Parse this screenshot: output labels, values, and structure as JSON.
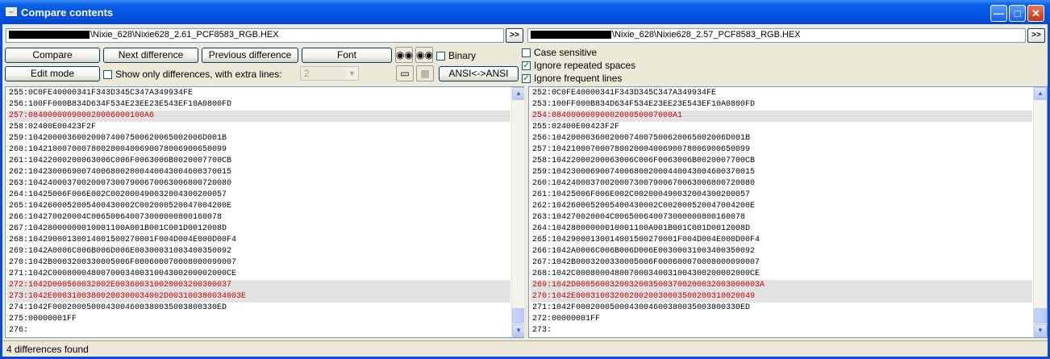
{
  "window": {
    "title": "Compare contents",
    "controls": [
      "minimize",
      "maximize",
      "close"
    ]
  },
  "left_file": {
    "path": "\\Nixie_628\\Nixie628_2.61_PCF8583_RGB.HEX",
    "browse_label": ">>"
  },
  "right_file": {
    "path": "\\Nixie_628\\Nixie628_2.57_PCF8583_RGB.HEX",
    "browse_label": ">>"
  },
  "toolbar": {
    "compare": "Compare",
    "next_difference": "Next difference",
    "previous_difference": "Previous difference",
    "font": "Font",
    "edit_mode": "Edit mode",
    "ansi": "ANSI<->ANSI",
    "find_icon": "binoculars-icon",
    "find_next_icon": "binoculars-next-icon",
    "split_icon": "layout-icon",
    "save_icon": "floppy-save-icon"
  },
  "options": {
    "binary": {
      "label": "Binary",
      "checked": false
    },
    "show_only_differences": {
      "label": "Show only differences, with extra lines:",
      "checked": false
    },
    "extra_lines_value": "2",
    "case_sensitive": {
      "label": "Case sensitive",
      "checked": false
    },
    "ignore_repeated_spaces": {
      "label": "Ignore repeated spaces",
      "checked": true
    },
    "ignore_frequent_lines": {
      "label": "Ignore frequent lines",
      "checked": true
    }
  },
  "left_lines": [
    {
      "n": "255",
      "t": ":0C0FE40000341F343D345C347A349934FE",
      "diff": false
    },
    {
      "n": "256",
      "t": ":100FF000B834D634F534E23EE23E543EF10A0800FD",
      "diff": false
    },
    {
      "n": "257",
      "t": ":084000000900020006000100A6",
      "diff": true
    },
    {
      "n": "258",
      "t": ":02400E00423F2F",
      "diff": false
    },
    {
      "n": "259",
      "t": ":104200003600200074007500620065002006D001B",
      "diff": false
    },
    {
      "n": "260",
      "t": ":10421000700078002000400690078006900650099",
      "diff": false
    },
    {
      "n": "261",
      "t": ":10422000200063006C006F0063006B0020007700CB",
      "diff": false
    },
    {
      "n": "262",
      "t": ":104230006900740068002000440043004600370015",
      "diff": false
    },
    {
      "n": "263",
      "t": ":104240003700200073007900670063006800720080",
      "diff": false
    },
    {
      "n": "264",
      "t": ":10425006F006E002C002000490032004300200057",
      "diff": false
    },
    {
      "n": "265",
      "t": ":1042600052005400430002C002000520047004200E",
      "diff": false
    },
    {
      "n": "266",
      "t": ":104270020004C006500640073000000800160078",
      "diff": false
    },
    {
      "n": "267",
      "t": ":10428000000010001100A001B001C001D0012008D",
      "diff": false
    },
    {
      "n": "268",
      "t": ":10429000130014001500270001F004D004E000D00F4",
      "diff": false
    },
    {
      "n": "269",
      "t": ":1042A0006C006B006D006E00300031003400350092",
      "diff": false
    },
    {
      "n": "270",
      "t": ":1042B0003200330005006F000600070008000090007",
      "diff": false
    },
    {
      "n": "271",
      "t": ":1042C000800048007000340031004300200002000CE",
      "diff": false
    },
    {
      "n": "272",
      "t": ":1042D000560032002E003600310020003200300037",
      "diff": true
    },
    {
      "n": "273",
      "t": ":1042E00031003800200300034002D003100380034003E",
      "diff": true
    },
    {
      "n": "274",
      "t": ":1042F0002000500043004600380035003800330ED",
      "diff": false
    },
    {
      "n": "275",
      "t": ":00000001FF",
      "diff": false
    },
    {
      "n": "276",
      "t": ":",
      "diff": false
    }
  ],
  "right_lines": [
    {
      "n": "252",
      "t": ":0C0FE40000341F343D345C347A349934FE",
      "diff": false
    },
    {
      "n": "253",
      "t": ":100FF000B834D634F534E23EE23E543EF10A0800FD",
      "diff": false
    },
    {
      "n": "254",
      "t": ":0840000009000200050007000A1",
      "diff": true
    },
    {
      "n": "255",
      "t": ":02400E00423F2F",
      "diff": false
    },
    {
      "n": "256",
      "t": ":104200003600200074007500620065002006D001B",
      "diff": false
    },
    {
      "n": "257",
      "t": ":10421000700078002000400690078006900650099",
      "diff": false
    },
    {
      "n": "258",
      "t": ":10422000200063006C006F0063006B0020007700CB",
      "diff": false
    },
    {
      "n": "259",
      "t": ":104230006900740068002000440043004600370015",
      "diff": false
    },
    {
      "n": "260",
      "t": ":104240003700200073007900670063006800720080",
      "diff": false
    },
    {
      "n": "261",
      "t": ":10425006F006E002C002000490032004300200057",
      "diff": false
    },
    {
      "n": "262",
      "t": ":1042600052005400430002C002000520047004200E",
      "diff": false
    },
    {
      "n": "263",
      "t": ":104270020004C006500640073000000800160078",
      "diff": false
    },
    {
      "n": "264",
      "t": ":10428000000010001100A001B001C001D0012008D",
      "diff": false
    },
    {
      "n": "265",
      "t": ":10429000130014001500270001F004D004E000D00F4",
      "diff": false
    },
    {
      "n": "266",
      "t": ":1042A0006C006B006D006E00300031003400350092",
      "diff": false
    },
    {
      "n": "267",
      "t": ":1042B0003200330005006F000600070008000090007",
      "diff": false
    },
    {
      "n": "268",
      "t": ":1042C000800048007000340031004300200002000CE",
      "diff": false
    },
    {
      "n": "269",
      "t": ":1042D00056003200320035003700200032003000003A",
      "diff": true
    },
    {
      "n": "270",
      "t": ":1042E0003100320020020030003500200310020049",
      "diff": true
    },
    {
      "n": "271",
      "t": ":1042F0002000500043004600380035003800330ED",
      "diff": false
    },
    {
      "n": "272",
      "t": ":00000001FF",
      "diff": false
    },
    {
      "n": "273",
      "t": ":",
      "diff": false
    }
  ],
  "status": "4 differences found"
}
